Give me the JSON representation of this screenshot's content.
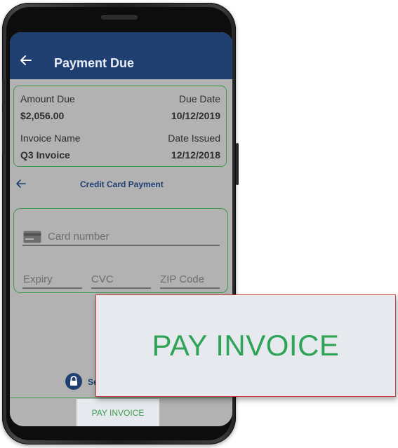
{
  "header": {
    "title": "Payment Due"
  },
  "summary": {
    "amount_due_label": "Amount Due",
    "amount_due_value": "$2,056.00",
    "due_date_label": "Due Date",
    "due_date_value": "10/12/2019",
    "invoice_name_label": "Invoice Name",
    "invoice_name_value": "Q3 Invoice",
    "date_issued_label": "Date Issued",
    "date_issued_value": "12/12/2018"
  },
  "payment_method": {
    "title": "Credit Card Payment"
  },
  "card_form": {
    "card_number_placeholder": "Card number",
    "expiry_placeholder": "Expiry",
    "cvc_placeholder": "CVC",
    "zip_placeholder": "ZIP Code"
  },
  "secure": {
    "text": "Se"
  },
  "actions": {
    "pay_label": "PAY INVOICE"
  },
  "callout": {
    "label": "PAY INVOICE"
  },
  "icons": {
    "back": "back-arrow-icon",
    "card": "credit-card-icon",
    "lock": "lock-icon"
  },
  "colors": {
    "appbar": "#1f3f70",
    "accent_green": "#3c9b4a",
    "pay_text": "#2fa356",
    "callout_border": "#cc3b3b",
    "screen_bg": "#b2b2b2"
  }
}
